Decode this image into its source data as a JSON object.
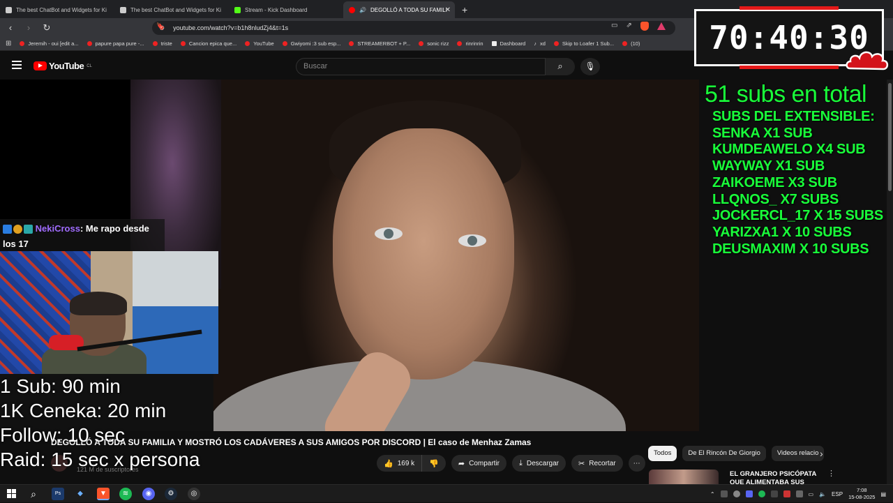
{
  "browser": {
    "tabs": [
      {
        "label": "The best ChatBot and Widgets for Ki",
        "color": "#cccccc",
        "active": false
      },
      {
        "label": "The best ChatBot and Widgets for Ki",
        "color": "#cccccc",
        "active": false
      },
      {
        "label": "Stream - Kick Dashboard",
        "color": "#53fc18",
        "active": false
      },
      {
        "label": "DEGOLLÓ A TODA SU FAMILI",
        "color": "#ff0000",
        "active": true
      }
    ],
    "new_tab": "+",
    "url": "youtube.com/watch?v=b1h8nludZj4&t=1s",
    "bookmarks": [
      "Jeremih - oui [edit a...",
      "papure papa pure -...",
      "triste",
      "Cancion epica que...",
      "YouTube",
      "Gwiyomi :3 sub esp...",
      "STREAMERBOT + P...",
      "sonic rizz",
      "rinrinrin",
      "Dashboard",
      "xd",
      "Skip to Loafer 1 Sub...",
      "(10)"
    ]
  },
  "youtube": {
    "logo": "YouTube",
    "country": "CL",
    "search_placeholder": "Buscar",
    "video_title": "DEGOLLÓ A TODA SU FAMILIA Y MOSTRÓ LOS CADÁVERES A SUS AMIGOS POR DISCORD | El caso de Menhaz Zamas",
    "subscribers": "121 M de suscriptores",
    "likes": "169 k",
    "share": "Compartir",
    "download": "Descargar",
    "clip": "Recortar",
    "chips": [
      "Todos",
      "De El Rincón De Giorgio",
      "Videos relacio"
    ],
    "rec_title": "EL GRANJERO PSICÓPATA QUE ALIMENTABA SUS CERDOS"
  },
  "overlay": {
    "chat": {
      "user": "NekiCross",
      "message": ": Me rapo desde",
      "message_cont": "los 17"
    },
    "stream_info": [
      "1 Sub: 90 min",
      "1K Ceneka: 20 min",
      "Follow: 10 sec",
      "Raid: 15 sec x persona"
    ],
    "timer": "70:40:30",
    "subs_total": "51 subs en total",
    "subs_header": "SUBS DEL EXTENSIBLE:",
    "subs": [
      "SENKA X1 SUB",
      "KUMDEAWELO X4 SUB",
      "WAYWAY X1 SUB",
      "ZAIKOEME X3 SUB",
      "LLQNOS_ X7 SUBS",
      "JOCKERCL_17 X 15 SUBS",
      "YARIZXA1 X 10 SUBS",
      "DEUSMAXIM X 10 SUBS"
    ]
  },
  "taskbar": {
    "lang": "ESP",
    "time": "7:08",
    "date": "15-08-2025"
  },
  "colors": {
    "sub_green": "#19ff3a",
    "yt_red": "#ff0000",
    "timer_red": "#e51919"
  }
}
